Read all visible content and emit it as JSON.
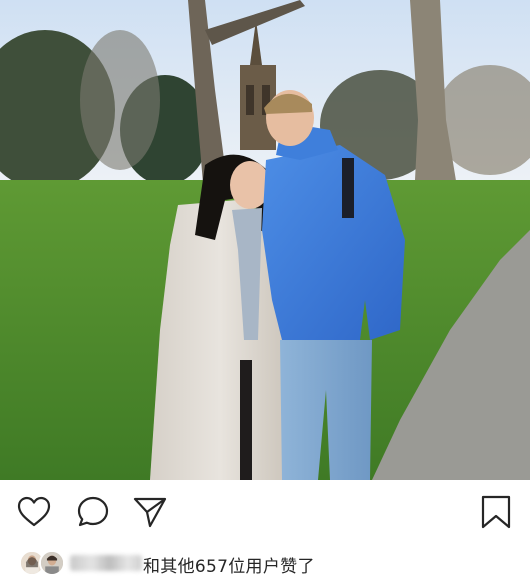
{
  "post": {
    "photo_icon": "park-couple-photo",
    "actions": {
      "like_icon": "heart-icon",
      "comment_icon": "comment-bubble-icon",
      "share_icon": "paper-plane-icon",
      "save_icon": "bookmark-icon"
    },
    "likes": {
      "text": "和其他657位用户赞了"
    }
  },
  "colors": {
    "icon": "#262626",
    "text": "#262626"
  }
}
